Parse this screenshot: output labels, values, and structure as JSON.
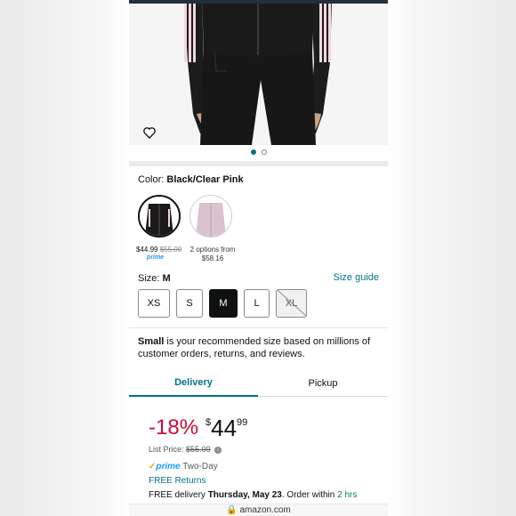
{
  "product": {
    "color_label": "Color:",
    "color_value": "Black/Clear Pink",
    "swatches": [
      {
        "price": "$44.99",
        "list_price": "$55.00",
        "badge": "prime"
      },
      {
        "options": "2 options from",
        "from_price": "$58.16"
      }
    ]
  },
  "size": {
    "label": "Size:",
    "selected": "M",
    "guide_label": "Size guide",
    "options": [
      "XS",
      "S",
      "M",
      "L",
      "XL"
    ],
    "recommend_bold": "Small",
    "recommend_text": " is your recommended size based on millions of customer orders, returns, and reviews."
  },
  "tabs": {
    "delivery": "Delivery",
    "pickup": "Pickup"
  },
  "pricing": {
    "discount": "-18%",
    "currency": "$",
    "whole": "44",
    "fraction": "99",
    "list_label": "List Price:",
    "list_value": "$55.00",
    "prime_label": "prime",
    "prime_speed": "Two-Day",
    "free_returns": "FREE Returns",
    "delivery_prefix": "FREE delivery ",
    "delivery_date": "Thursday, May 23",
    "delivery_middle": ". Order within ",
    "delivery_window": "2 hrs"
  },
  "browser": {
    "url": "amazon.com"
  },
  "colors": {
    "accent": "#007185",
    "discount": "#cc0c39",
    "prime": "#1a98ff"
  }
}
